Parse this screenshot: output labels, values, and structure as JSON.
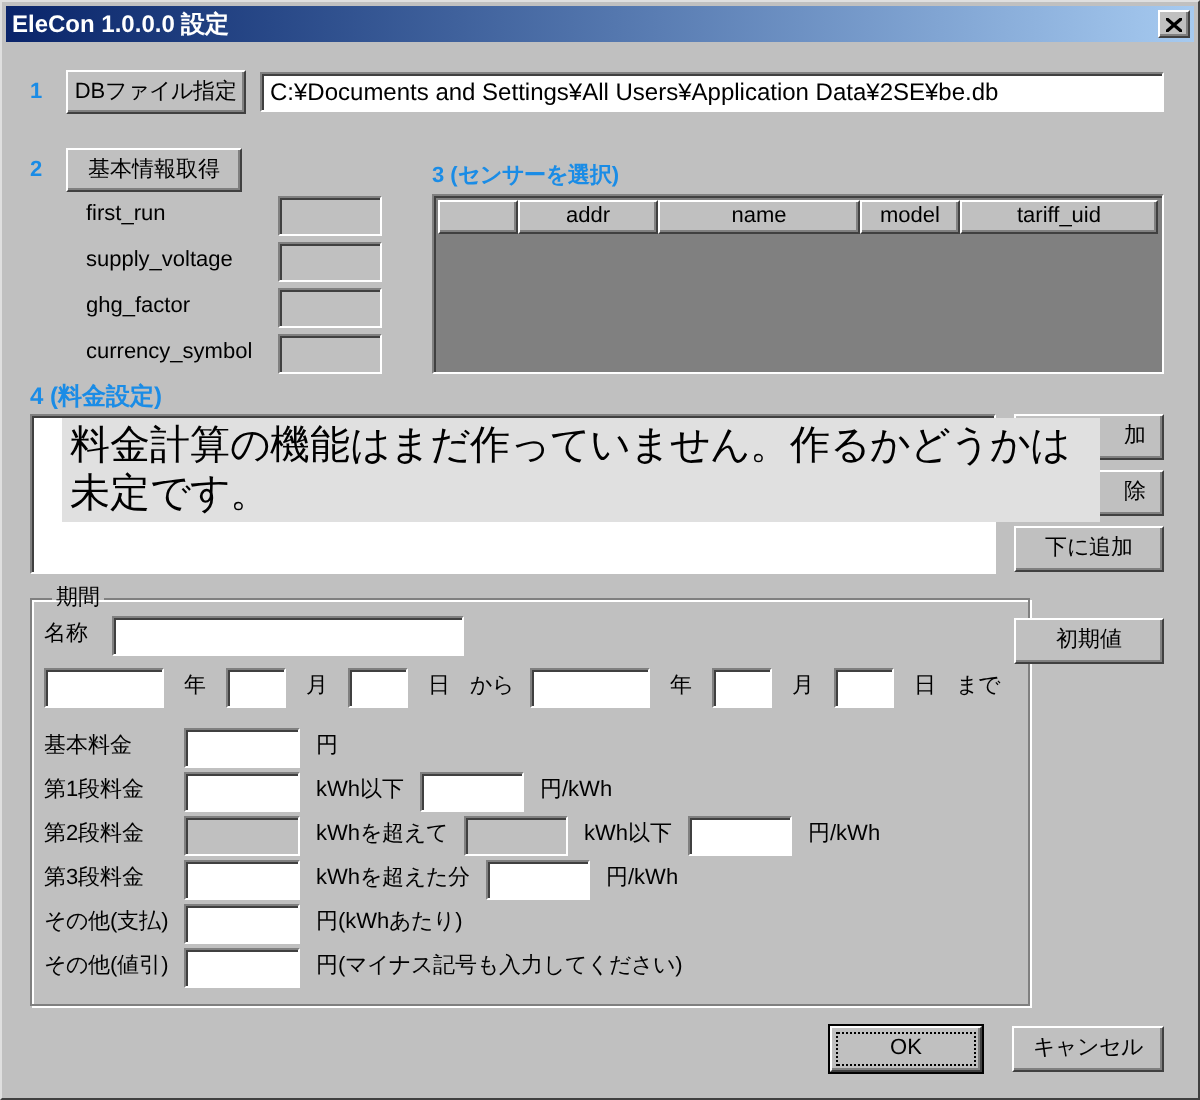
{
  "window": {
    "title": "EleCon 1.0.0.0 設定"
  },
  "step1": {
    "number": "1",
    "button": "DBファイル指定",
    "path": "C:¥Documents and Settings¥All Users¥Application Data¥2SE¥be.db"
  },
  "step2": {
    "number": "2",
    "button": "基本情報取得",
    "fields": [
      {
        "label": "first_run",
        "disabled": true
      },
      {
        "label": "supply_voltage",
        "disabled": true
      },
      {
        "label": "ghg_factor",
        "disabled": true
      },
      {
        "label": "currency_symbol",
        "disabled": true
      }
    ]
  },
  "step3": {
    "title": "3 (センサーを選択)",
    "columns": [
      "addr",
      "name",
      "model",
      "tariff_uid"
    ]
  },
  "step4": {
    "title": "4 (料金設定)",
    "side_buttons": [
      "加",
      "除",
      "下に追加",
      "初期値"
    ],
    "tooltip": "料金計算の機能はまだ作っていません。作るかどうかは未定です。",
    "period": {
      "legend": "期間",
      "name_label": "名称",
      "date_row": [
        {
          "kind": "year",
          "text": "年"
        },
        {
          "kind": "month",
          "text": "月"
        },
        {
          "kind": "day",
          "text": "日"
        },
        {
          "kind": "word",
          "text": "から"
        },
        {
          "kind": "year",
          "text": "年"
        },
        {
          "kind": "month",
          "text": "月"
        },
        {
          "kind": "day",
          "text": "日"
        },
        {
          "kind": "word",
          "text": "まで"
        }
      ],
      "fee_rows": [
        {
          "label": "基本料金",
          "parts": [
            {
              "kind": "field",
              "disabled": false
            },
            {
              "kind": "text",
              "text": "円"
            }
          ]
        },
        {
          "label": "第1段料金",
          "parts": [
            {
              "kind": "field",
              "disabled": false
            },
            {
              "kind": "text",
              "text": "kWh以下"
            },
            {
              "kind": "field",
              "disabled": false
            },
            {
              "kind": "text",
              "text": "円/kWh"
            }
          ]
        },
        {
          "label": "第2段料金",
          "parts": [
            {
              "kind": "field",
              "disabled": true
            },
            {
              "kind": "text",
              "text": "kWhを超えて"
            },
            {
              "kind": "field",
              "disabled": true
            },
            {
              "kind": "text",
              "text": "kWh以下"
            },
            {
              "kind": "field",
              "disabled": false
            },
            {
              "kind": "text",
              "text": "円/kWh"
            }
          ]
        },
        {
          "label": "第3段料金",
          "parts": [
            {
              "kind": "field",
              "disabled": false
            },
            {
              "kind": "text",
              "text": "kWhを超えた分"
            },
            {
              "kind": "field",
              "disabled": false
            },
            {
              "kind": "text",
              "text": "円/kWh"
            }
          ]
        },
        {
          "label": "その他(支払)",
          "parts": [
            {
              "kind": "field",
              "disabled": false
            },
            {
              "kind": "text",
              "text": "円(kWhあたり)"
            }
          ]
        },
        {
          "label": "その他(値引)",
          "parts": [
            {
              "kind": "field",
              "disabled": false
            },
            {
              "kind": "text",
              "text": "円(マイナス記号も入力してください)"
            }
          ]
        }
      ]
    }
  },
  "buttons": [
    {
      "label": "OK",
      "default": true
    },
    {
      "label": "キャンセル",
      "default": false
    }
  ]
}
